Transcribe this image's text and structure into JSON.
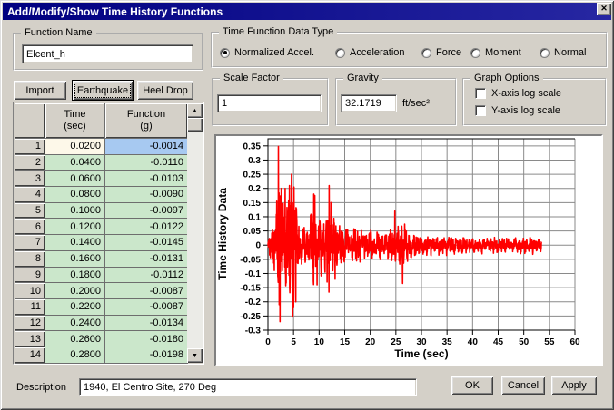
{
  "window": {
    "title": "Add/Modify/Show Time History Functions"
  },
  "icons": {
    "close": "✕",
    "scroll_up": "▲",
    "scroll_down": "▼"
  },
  "function_name": {
    "label": "Function Name",
    "value": "Elcent_h"
  },
  "action_buttons": {
    "import": "Import",
    "earthquake": "Earthquake",
    "heel_drop": "Heel Drop"
  },
  "data_type": {
    "label": "Time Function Data Type",
    "options": [
      {
        "label": "Normalized Accel.",
        "selected": true
      },
      {
        "label": "Acceleration",
        "selected": false
      },
      {
        "label": "Force",
        "selected": false
      },
      {
        "label": "Moment",
        "selected": false
      },
      {
        "label": "Normal",
        "selected": false
      }
    ]
  },
  "scale_factor": {
    "label": "Scale Factor",
    "value": "1"
  },
  "gravity": {
    "label": "Gravity",
    "value": "32.1719",
    "unit": "ft/sec²"
  },
  "graph_options": {
    "label": "Graph Options",
    "checkboxes": [
      {
        "label": "X-axis log scale",
        "checked": false
      },
      {
        "label": "Y-axis log scale",
        "checked": false
      }
    ]
  },
  "table": {
    "columns": [
      {
        "line1": "",
        "line2": ""
      },
      {
        "line1": "Time",
        "line2": "(sec)"
      },
      {
        "line1": "Function",
        "line2": "(g)"
      }
    ],
    "rows": [
      {
        "n": "1",
        "time": "0.0200",
        "value": "-0.0014"
      },
      {
        "n": "2",
        "time": "0.0400",
        "value": "-0.0110"
      },
      {
        "n": "3",
        "time": "0.0600",
        "value": "-0.0103"
      },
      {
        "n": "4",
        "time": "0.0800",
        "value": "-0.0090"
      },
      {
        "n": "5",
        "time": "0.1000",
        "value": "-0.0097"
      },
      {
        "n": "6",
        "time": "0.1200",
        "value": "-0.0122"
      },
      {
        "n": "7",
        "time": "0.1400",
        "value": "-0.0145"
      },
      {
        "n": "8",
        "time": "0.1600",
        "value": "-0.0131"
      },
      {
        "n": "9",
        "time": "0.1800",
        "value": "-0.0112"
      },
      {
        "n": "10",
        "time": "0.2000",
        "value": "-0.0087"
      },
      {
        "n": "11",
        "time": "0.2200",
        "value": "-0.0087"
      },
      {
        "n": "12",
        "time": "0.2400",
        "value": "-0.0134"
      },
      {
        "n": "13",
        "time": "0.2600",
        "value": "-0.0180"
      },
      {
        "n": "14",
        "time": "0.2800",
        "value": "-0.0198"
      }
    ]
  },
  "description": {
    "label": "Description",
    "value": "1940, El Centro Site, 270 Deg"
  },
  "dialog_buttons": {
    "ok": "OK",
    "cancel": "Cancel",
    "apply": "Apply"
  },
  "chart_data": {
    "type": "line",
    "title": "",
    "xlabel": "Time (sec)",
    "ylabel": "Time History Data",
    "xlim": [
      0,
      60
    ],
    "ylim": [
      -0.3,
      0.375
    ],
    "xticks": [
      0,
      5,
      10,
      15,
      20,
      25,
      30,
      35,
      40,
      45,
      50,
      55,
      60
    ],
    "ytick_labels": [
      "0.35",
      "0.3",
      "0.25",
      "0.2",
      "0.15",
      "0.1",
      "0.05",
      "0",
      "-0.05",
      "-0.1",
      "-0.15",
      "-0.2",
      "-0.25",
      "-0.3"
    ],
    "grid": true,
    "line_color": "#ff0000",
    "grid_color": "#8a8a8a",
    "frame_color": "#000000",
    "duration": 53.5,
    "sample_dt": 0.04,
    "seed": 9,
    "amplitude_envelope": [
      [
        0,
        0.01
      ],
      [
        0.3,
        0.05
      ],
      [
        1.0,
        0.1
      ],
      [
        1.7,
        0.16
      ],
      [
        2.0,
        0.3
      ],
      [
        2.4,
        0.26
      ],
      [
        3.0,
        0.17
      ],
      [
        3.8,
        0.18
      ],
      [
        4.6,
        0.24
      ],
      [
        5.2,
        0.2
      ],
      [
        5.8,
        0.12
      ],
      [
        6.5,
        0.07
      ],
      [
        7.5,
        0.07
      ],
      [
        8.8,
        0.15
      ],
      [
        9.3,
        0.16
      ],
      [
        10.0,
        0.1
      ],
      [
        11.0,
        0.1
      ],
      [
        11.9,
        0.17
      ],
      [
        12.4,
        0.11
      ],
      [
        13.2,
        0.12
      ],
      [
        14.0,
        0.09
      ],
      [
        15.0,
        0.07
      ],
      [
        16.0,
        0.06
      ],
      [
        17.0,
        0.08
      ],
      [
        18.0,
        0.07
      ],
      [
        19.5,
        0.06
      ],
      [
        21.0,
        0.06
      ],
      [
        22.5,
        0.05
      ],
      [
        24.0,
        0.06
      ],
      [
        25.2,
        0.06
      ],
      [
        26.2,
        0.11
      ],
      [
        26.8,
        0.08
      ],
      [
        28.0,
        0.05
      ],
      [
        29.0,
        0.045
      ],
      [
        30.0,
        0.04
      ],
      [
        32.0,
        0.035
      ],
      [
        34.0,
        0.04
      ],
      [
        36.0,
        0.035
      ],
      [
        38.0,
        0.03
      ],
      [
        40.0,
        0.03
      ],
      [
        42.0,
        0.028
      ],
      [
        44.0,
        0.032
      ],
      [
        46.0,
        0.028
      ],
      [
        48.0,
        0.028
      ],
      [
        50.0,
        0.035
      ],
      [
        51.5,
        0.03
      ],
      [
        53.0,
        0.025
      ],
      [
        53.5,
        0.02
      ]
    ],
    "notable_peaks": [
      [
        1.7,
        0.155
      ],
      [
        2.05,
        0.348
      ],
      [
        2.2,
        -0.21
      ],
      [
        2.35,
        -0.27
      ],
      [
        2.6,
        0.2
      ],
      [
        3.35,
        0.2
      ],
      [
        4.2,
        0.21
      ],
      [
        4.6,
        0.25
      ],
      [
        4.85,
        -0.253
      ],
      [
        5.1,
        0.205
      ],
      [
        5.45,
        -0.2
      ],
      [
        8.95,
        0.18
      ],
      [
        9.15,
        0.175
      ],
      [
        9.6,
        -0.14
      ],
      [
        11.55,
        -0.13
      ],
      [
        11.95,
        0.21
      ],
      [
        12.3,
        0.15
      ],
      [
        13.1,
        -0.12
      ],
      [
        24.8,
        0.12
      ],
      [
        26.3,
        -0.135
      ]
    ]
  }
}
